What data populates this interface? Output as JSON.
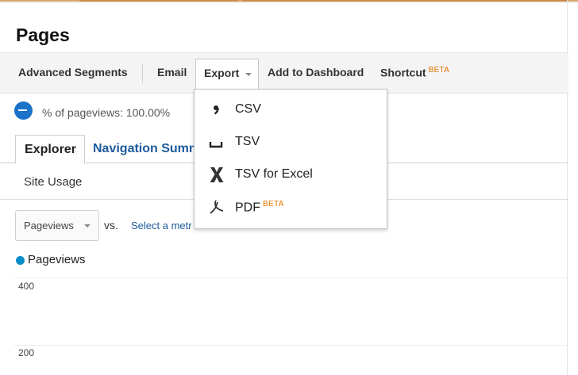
{
  "page": {
    "title": "Pages"
  },
  "toolbar": {
    "advanced_segments": "Advanced Segments",
    "email": "Email",
    "export": "Export",
    "add_to_dashboard": "Add to Dashboard",
    "shortcut": "Shortcut",
    "shortcut_badge": "BETA"
  },
  "segment": {
    "text": "% of pageviews: 100.00%"
  },
  "tabs": {
    "explorer": "Explorer",
    "navigation_summary": "Navigation Summ"
  },
  "subtab": {
    "site_usage": "Site Usage"
  },
  "chart_controls": {
    "metric": "Pageviews",
    "vs": "vs.",
    "select_metric": "Select a metr"
  },
  "chart": {
    "legend": "Pageviews",
    "y_ticks": [
      "400",
      "200"
    ],
    "series_color": "#058dc7"
  },
  "export_menu": {
    "items": [
      {
        "label": "CSV",
        "icon": "comma-icon"
      },
      {
        "label": "TSV",
        "icon": "tab-bracket-icon"
      },
      {
        "label": "TSV for Excel",
        "icon": "excel-x-icon"
      },
      {
        "label": "PDF",
        "icon": "acrobat-icon",
        "badge": "BETA"
      }
    ]
  },
  "colors": {
    "link": "#1c5a9c",
    "beta": "#e37400",
    "segment": "#1a73c9"
  }
}
